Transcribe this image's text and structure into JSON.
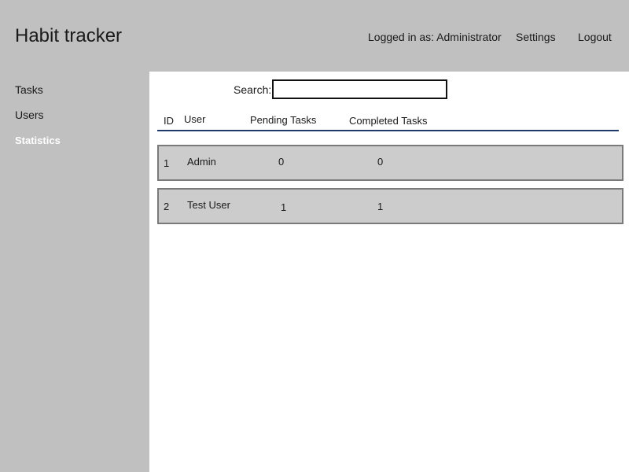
{
  "header": {
    "title": "Habit tracker",
    "logged_in": "Logged in as: Administrator",
    "settings": "Settings",
    "logout": "Logout"
  },
  "sidebar": {
    "items": [
      {
        "label": "Tasks"
      },
      {
        "label": "Users"
      },
      {
        "label": "Statistics"
      }
    ]
  },
  "search": {
    "label": "Search:",
    "value": "",
    "placeholder": ""
  },
  "table": {
    "columns": [
      "ID",
      "User",
      "Pending Tasks",
      "Completed Tasks"
    ],
    "rows": [
      {
        "id": "1",
        "user": "Admin",
        "pending": "0",
        "completed": "0"
      },
      {
        "id": "2",
        "user": "Test User",
        "pending": "1",
        "completed": "1"
      }
    ]
  },
  "colors": {
    "header_bg": "#c0c0c0",
    "content_bg": "#ffffff",
    "row_bg": "#cccccc",
    "row_border": "#7a7a7a",
    "header_rule": "#1f3a6b"
  }
}
